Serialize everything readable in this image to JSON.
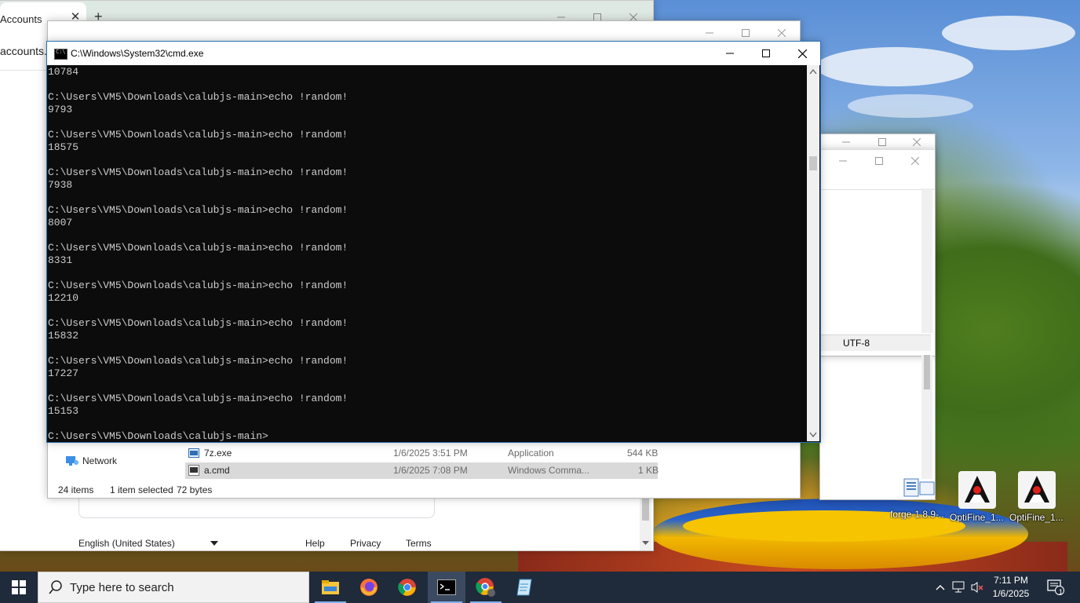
{
  "browser": {
    "tab_title": "Accounts",
    "tab_close": "✕",
    "new_tab": "+",
    "address": "accounts.g",
    "footer": {
      "language": "English (United States)",
      "help": "Help",
      "privacy": "Privacy",
      "terms": "Terms"
    }
  },
  "explorer": {
    "nav": {
      "network": "Network"
    },
    "files": [
      {
        "name": "7z.exe",
        "date": "1/6/2025 3:51 PM",
        "type": "Application",
        "size": "544 KB"
      },
      {
        "name": "a.cmd",
        "date": "1/6/2025 7:08 PM",
        "type": "Windows Comma...",
        "size": "1 KB"
      }
    ],
    "status": {
      "items": "24 items",
      "selected": "1 item selected",
      "bytes": "72 bytes"
    }
  },
  "notepad": {
    "encoding": "UTF-8"
  },
  "cmd": {
    "title": "C:\\Windows\\System32\\cmd.exe",
    "lines": [
      "10784",
      "",
      "C:\\Users\\VM5\\Downloads\\calubjs-main>echo !random!",
      "9793",
      "",
      "C:\\Users\\VM5\\Downloads\\calubjs-main>echo !random!",
      "18575",
      "",
      "C:\\Users\\VM5\\Downloads\\calubjs-main>echo !random!",
      "7938",
      "",
      "C:\\Users\\VM5\\Downloads\\calubjs-main>echo !random!",
      "8007",
      "",
      "C:\\Users\\VM5\\Downloads\\calubjs-main>echo !random!",
      "8331",
      "",
      "C:\\Users\\VM5\\Downloads\\calubjs-main>echo !random!",
      "12210",
      "",
      "C:\\Users\\VM5\\Downloads\\calubjs-main>echo !random!",
      "15832",
      "",
      "C:\\Users\\VM5\\Downloads\\calubjs-main>echo !random!",
      "17227",
      "",
      "C:\\Users\\VM5\\Downloads\\calubjs-main>echo !random!",
      "15153",
      "",
      "C:\\Users\\VM5\\Downloads\\calubjs-main>"
    ]
  },
  "desktop_icons": [
    {
      "label": "forge-1.8.9-...",
      "icon": "installer-icon"
    },
    {
      "label": "OptiFine_1....",
      "icon": "java-duke-icon"
    },
    {
      "label": "OptiFine_1....",
      "icon": "java-duke-icon"
    }
  ],
  "taskbar": {
    "search_placeholder": "Type here to search",
    "apps": [
      "file-explorer-icon",
      "firefox-icon",
      "chrome-icon",
      "cmd-icon",
      "chrome-settings-icon",
      "notepad-icon"
    ],
    "time": "7:11 PM",
    "date": "1/6/2025",
    "notifications_count": "1"
  },
  "colors": {
    "taskbar": "#1f2a3a",
    "console_bg": "#0c0c0c",
    "console_text": "#cccccc",
    "selection": "#d9d9d9"
  }
}
